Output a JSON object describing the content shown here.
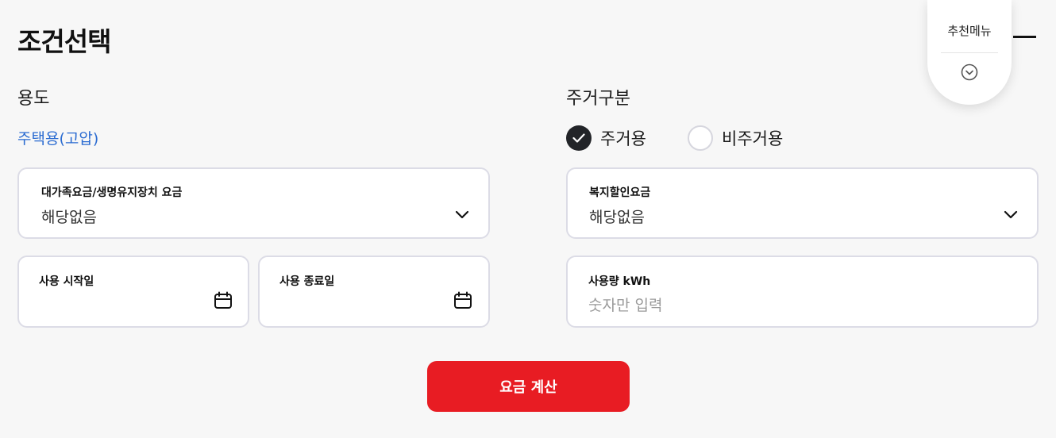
{
  "page": {
    "title": "조건선택"
  },
  "usage": {
    "label": "용도",
    "value": "주택용(고압)"
  },
  "residence": {
    "label": "주거구분",
    "options": [
      {
        "label": "주거용",
        "selected": true
      },
      {
        "label": "비주거용",
        "selected": false
      }
    ]
  },
  "family_fee": {
    "label": "대가족요금/생명유지장치 요금",
    "value": "해당없음"
  },
  "welfare_discount": {
    "label": "복지할인요금",
    "value": "해당없음"
  },
  "start_date": {
    "label": "사용 시작일",
    "value": ""
  },
  "end_date": {
    "label": "사용 종료일",
    "value": ""
  },
  "usage_kwh": {
    "label": "사용량 kWh",
    "placeholder": "숫자만 입력",
    "value": ""
  },
  "calculate_button": {
    "label": "요금 계산"
  },
  "recommend_menu": {
    "label": "추천메뉴",
    "icon": "chevron-circle-down-icon"
  },
  "colors": {
    "accent_red": "#e81c23",
    "link_blue": "#2a6bd1",
    "selected_dark": "#222428"
  }
}
